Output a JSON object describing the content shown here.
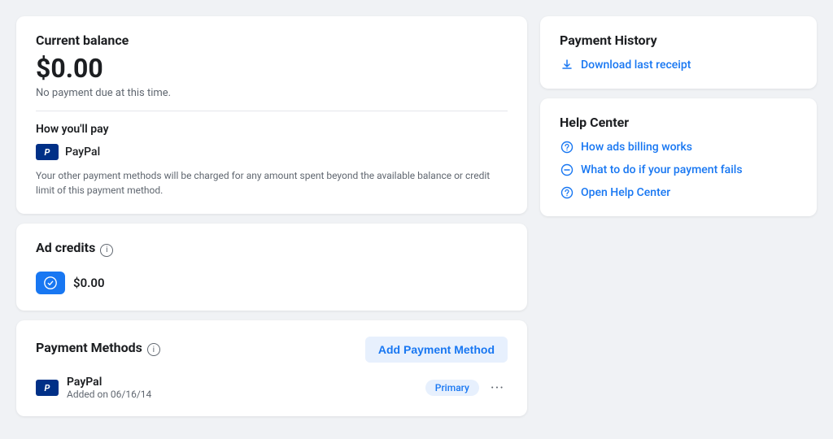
{
  "left": {
    "current_balance": {
      "title": "Current balance",
      "amount": "$0.00",
      "note": "No payment due at this time.",
      "how_you_pay": "How you'll pay",
      "paypal_label": "PayPal",
      "payment_note": "Your other payment methods will be charged for any amount spent beyond the available balance or credit limit of this payment method."
    },
    "ad_credits": {
      "title": "Ad credits",
      "amount": "$0.00"
    },
    "payment_methods": {
      "title": "Payment Methods",
      "add_btn": "Add Payment Method",
      "paypal_name": "PayPal",
      "paypal_date": "Added on 06/16/14",
      "primary_label": "Primary"
    }
  },
  "right": {
    "payment_history": {
      "title": "Payment History",
      "download_label": "Download last receipt"
    },
    "help_center": {
      "title": "Help Center",
      "link1": "How ads billing works",
      "link2": "What to do if your payment fails",
      "link3": "Open Help Center"
    }
  }
}
